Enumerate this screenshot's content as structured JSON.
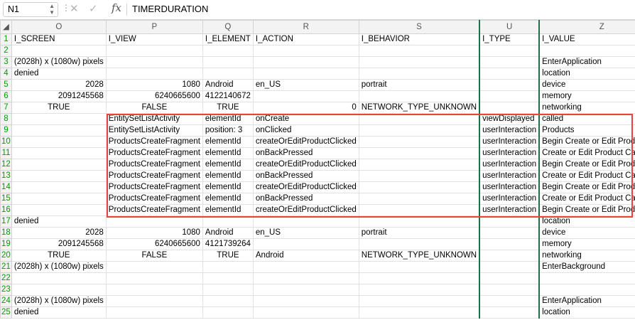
{
  "formula_bar": {
    "name_box": "N1",
    "cancel_icon": "✕",
    "enter_icon": "✓",
    "fx_label": "fx",
    "formula": "TIMERDURATION"
  },
  "columns": [
    "O",
    "P",
    "Q",
    "R",
    "S",
    "U",
    "Z"
  ],
  "rows": [
    {
      "n": "1",
      "c": [
        "I_SCREEN",
        "I_VIEW",
        "I_ELEMENT",
        "I_ACTION",
        "I_BEHAVIOR",
        "I_TYPE",
        "I_VALUE"
      ]
    },
    {
      "n": "2",
      "c": [
        "",
        "",
        "",
        "",
        "",
        "",
        ""
      ]
    },
    {
      "n": "3",
      "c": [
        "(2028h) x (1080w) pixels",
        "",
        "",
        "",
        "",
        "",
        "EnterApplication"
      ]
    },
    {
      "n": "4",
      "c": [
        "denied",
        "",
        "",
        "",
        "",
        "",
        "location"
      ]
    },
    {
      "n": "5",
      "c": [
        "2028",
        "1080",
        "Android",
        "en_US",
        "portrait",
        "",
        "device"
      ]
    },
    {
      "n": "6",
      "c": [
        "2091245568",
        "6240665600",
        "4122140672",
        "",
        "",
        "",
        "memory"
      ]
    },
    {
      "n": "7",
      "c": [
        "TRUE",
        "FALSE",
        "TRUE",
        "0",
        "NETWORK_TYPE_UNKNOWN",
        "",
        "networking"
      ]
    },
    {
      "n": "8",
      "c": [
        "",
        "EntitySetListActivity",
        "elementId",
        "onCreate",
        "",
        "viewDisplayed",
        "called"
      ]
    },
    {
      "n": "9",
      "c": [
        "",
        "EntitySetListActivity",
        "position: 3",
        "onClicked",
        "",
        "userInteraction",
        "Products"
      ]
    },
    {
      "n": "10",
      "c": [
        "",
        "ProductsCreateFragment",
        "elementId",
        "createOrEditProductClicked",
        "",
        "userInteraction",
        "Begin Create or Edit Product"
      ]
    },
    {
      "n": "11",
      "c": [
        "",
        "ProductsCreateFragment",
        "elementId",
        "onBackPressed",
        "",
        "userInteraction",
        "Create or Edit Product Cancelled"
      ]
    },
    {
      "n": "12",
      "c": [
        "",
        "ProductsCreateFragment",
        "elementId",
        "createOrEditProductClicked",
        "",
        "userInteraction",
        "Begin Create or Edit Product"
      ]
    },
    {
      "n": "13",
      "c": [
        "",
        "ProductsCreateFragment",
        "elementId",
        "onBackPressed",
        "",
        "userInteraction",
        "Create or Edit Product Cancelled"
      ]
    },
    {
      "n": "14",
      "c": [
        "",
        "ProductsCreateFragment",
        "elementId",
        "createOrEditProductClicked",
        "",
        "userInteraction",
        "Begin Create or Edit Product"
      ]
    },
    {
      "n": "15",
      "c": [
        "",
        "ProductsCreateFragment",
        "elementId",
        "onBackPressed",
        "",
        "userInteraction",
        "Create or Edit Product Cancelled"
      ]
    },
    {
      "n": "16",
      "c": [
        "",
        "ProductsCreateFragment",
        "elementId",
        "createOrEditProductClicked",
        "",
        "userInteraction",
        "Begin Create or Edit Product"
      ]
    },
    {
      "n": "17",
      "c": [
        "denied",
        "",
        "",
        "",
        "",
        "",
        "location"
      ]
    },
    {
      "n": "18",
      "c": [
        "2028",
        "1080",
        "Android",
        "en_US",
        "portrait",
        "",
        "device"
      ]
    },
    {
      "n": "19",
      "c": [
        "2091245568",
        "6240665600",
        "4121739264",
        "",
        "",
        "",
        "memory"
      ]
    },
    {
      "n": "20",
      "c": [
        "TRUE",
        "FALSE",
        "TRUE",
        "Android",
        "NETWORK_TYPE_UNKNOWN",
        "",
        "networking"
      ]
    },
    {
      "n": "21",
      "c": [
        "(2028h) x (1080w) pixels",
        "",
        "",
        "",
        "",
        "",
        "EnterBackground"
      ]
    },
    {
      "n": "22",
      "c": [
        "",
        "",
        "",
        "",
        "",
        "",
        ""
      ]
    },
    {
      "n": "23",
      "c": [
        "",
        "",
        "",
        "",
        "",
        "",
        ""
      ]
    },
    {
      "n": "24",
      "c": [
        "(2028h) x (1080w) pixels",
        "",
        "",
        "",
        "",
        "",
        "EnterApplication"
      ]
    },
    {
      "n": "25",
      "c": [
        "denied",
        "",
        "",
        "",
        "",
        "",
        "location"
      ]
    }
  ],
  "colors": {
    "highlight_box": "#e8433e",
    "selection": "#1e7145",
    "row_header_text": "#00a000"
  }
}
